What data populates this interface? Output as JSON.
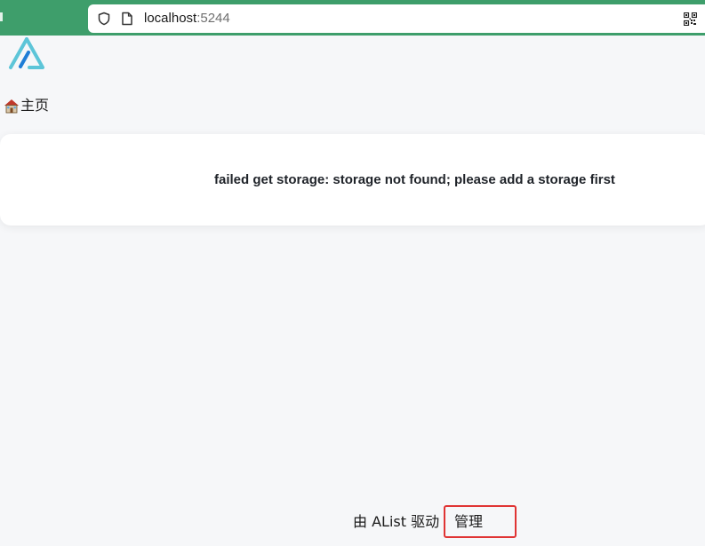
{
  "browser": {
    "url_host": "localhost",
    "url_port": ":5244",
    "icons": [
      "shield-icon",
      "page-icon",
      "qr-code-icon"
    ],
    "bar_color": "#3e9e6b"
  },
  "app": {
    "logo": "alist-logo",
    "logo_colors": [
      "#5dc5d8",
      "#1f7dd6"
    ]
  },
  "breadcrumb": {
    "home_icon": "house-icon",
    "home_label": "主页"
  },
  "message": {
    "error": "failed get storage: storage not found; please add a storage first"
  },
  "footer": {
    "powered_by": "由 AList 驱动",
    "manage_label": "管理"
  },
  "annotation": {
    "highlight_color": "#e03434"
  }
}
